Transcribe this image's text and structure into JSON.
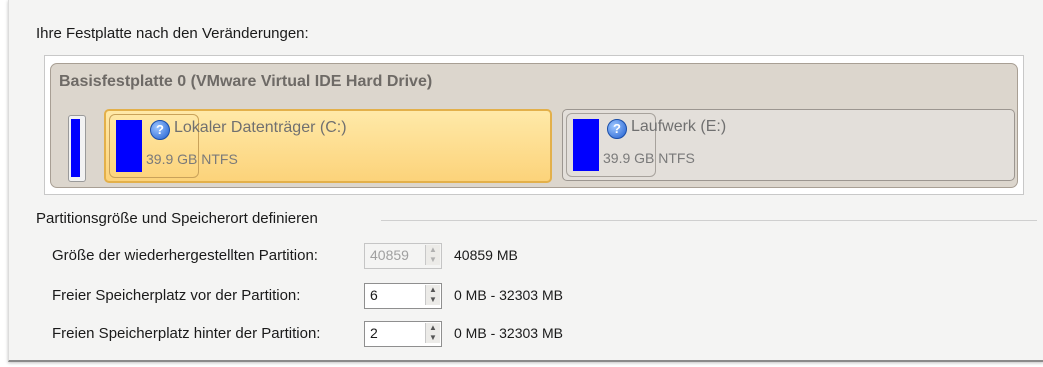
{
  "heading": "Ihre Festplatte nach den Veränderungen:",
  "disk": {
    "title": "Basisfestplatte 0 (VMware Virtual IDE Hard Drive)",
    "partitions": [
      {
        "name": "Lokaler Datenträger (C:)",
        "info": "39.9 GB NTFS",
        "icon": "question-icon",
        "selected": true
      },
      {
        "name": "Laufwerk (E:)",
        "info": "39.9 GB NTFS",
        "icon": "question-icon",
        "selected": false
      }
    ]
  },
  "group_title": "Partitionsgröße und Speicherort definieren",
  "rows": [
    {
      "label": "Größe der wiederhergestellten Partition:",
      "value": "40859",
      "range": "40859 MB",
      "disabled": true
    },
    {
      "label": "Freier Speicherplatz vor der Partition:",
      "value": "6",
      "range": "0 MB - 32303 MB",
      "disabled": false
    },
    {
      "label": "Freien Speicherplatz hinter der Partition:",
      "value": "2",
      "range": "0 MB - 32303 MB",
      "disabled": false
    }
  ],
  "colors": {
    "selected_fill": "#fcd37a",
    "usage_bar": "#0000ff",
    "disk_bg": "#dcd6cd"
  }
}
